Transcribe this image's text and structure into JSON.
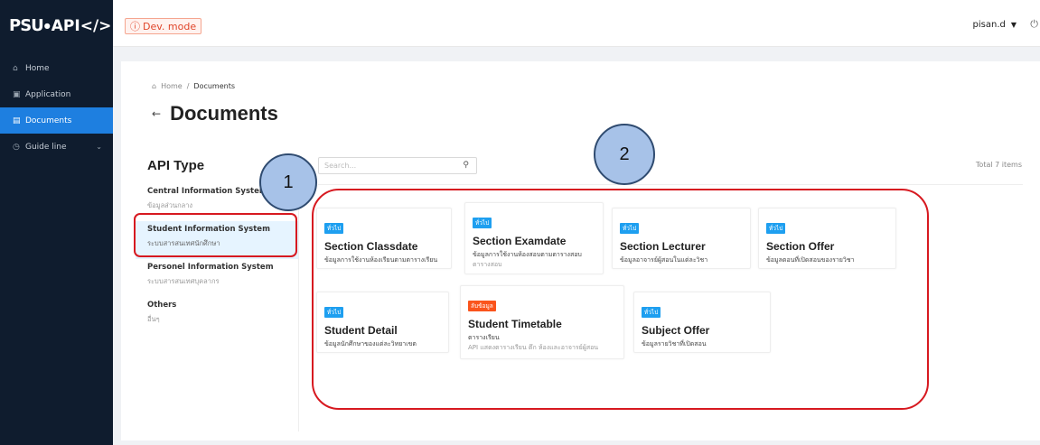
{
  "logo": {
    "psu": "PSU",
    "api": "API</>"
  },
  "sidebar": {
    "items": [
      {
        "label": "Home",
        "icon": "home-icon"
      },
      {
        "label": "Application",
        "icon": "application-icon"
      },
      {
        "label": "Documents",
        "icon": "document-icon"
      },
      {
        "label": "Guide line",
        "icon": "guide-icon"
      }
    ]
  },
  "topbar": {
    "devmode": "Dev. mode",
    "user": "pisan.d"
  },
  "breadcrumb": {
    "home": "Home",
    "separator": "/",
    "current": "Documents"
  },
  "page": {
    "title": "Documents"
  },
  "api_type": {
    "heading": "API Type",
    "types": [
      {
        "title": "Central Information System",
        "sub": "ข้อมูลส่วนกลาง"
      },
      {
        "title": "Student Information System",
        "sub": "ระบบสารสนเทศนักศึกษา"
      },
      {
        "title": "Personel Information System",
        "sub": "ระบบสารสนเทศบุคลากร"
      },
      {
        "title": "Others",
        "sub": "อื่นๆ"
      }
    ]
  },
  "search": {
    "placeholder": "Search..."
  },
  "total": "Total 7 items",
  "cards": [
    {
      "tag": "ทั่วไป",
      "title": "Section Classdate",
      "desc": "ข้อมูลการใช้งานห้องเรียนตามตารางเรียน",
      "desc2": ""
    },
    {
      "tag": "ทั่วไป",
      "title": "Section Examdate",
      "desc": "ข้อมูลการใช้งานห้องสอบตามตารางสอบ",
      "desc2": "ตารางสอบ"
    },
    {
      "tag": "ทั่วไป",
      "title": "Section Lecturer",
      "desc": "ข้อมูลอาจารย์ผู้สอนในแต่ละวิชา",
      "desc2": ""
    },
    {
      "tag": "ทั่วไป",
      "title": "Section Offer",
      "desc": "ข้อมูลตอนที่เปิดสอนของรายวิชา",
      "desc2": ""
    },
    {
      "tag": "ทั่วไป",
      "title": "Student Detail",
      "desc": "ข้อมูลนักศึกษาของแต่ละวิทยาเขต",
      "desc2": ""
    },
    {
      "tag": "ลับข้อมูล",
      "title": "Student Timetable",
      "desc": "ตารางเรียน",
      "desc2": "API แสดงตารางเรียน ตึก ห้องและอาจารย์ผู้สอน"
    },
    {
      "tag": "ทั่วไป",
      "title": "Subject Offer",
      "desc": "ข้อมูลรายวิชาที่เปิดสอน",
      "desc2": ""
    }
  ],
  "annotations": {
    "one": "1",
    "two": "2"
  },
  "colors": {
    "sidebar": "#0f1c2e",
    "accent": "#1e7fe0",
    "tag": "#1e9ff0",
    "tag_orange": "#fa541c",
    "annotation_red": "#d71920"
  }
}
